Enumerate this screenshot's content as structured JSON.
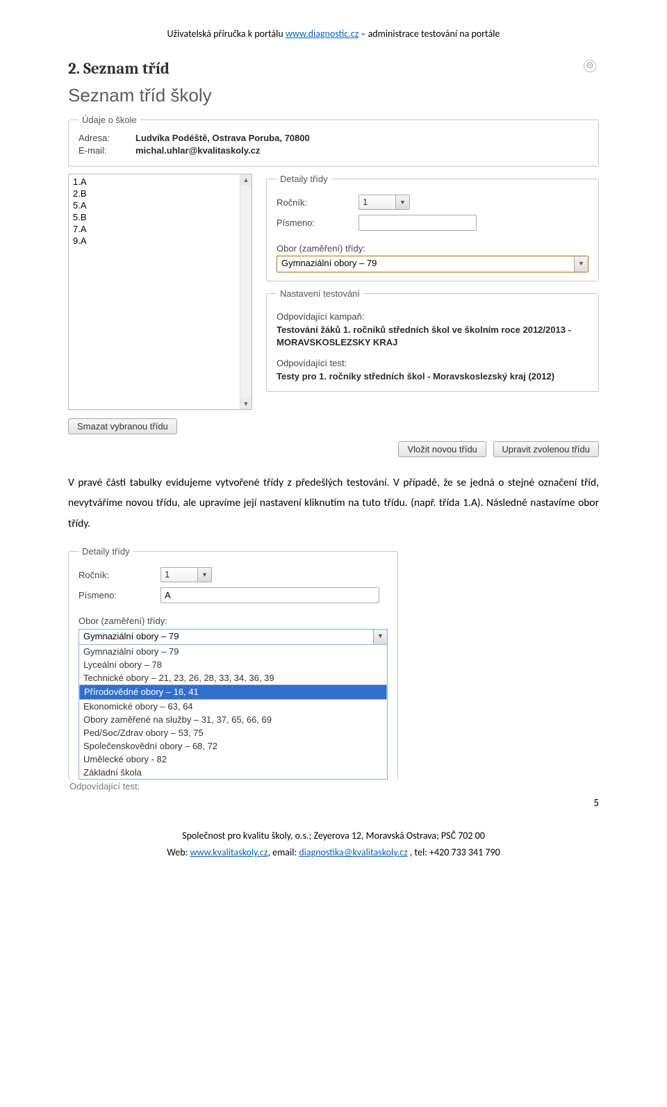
{
  "header": {
    "prefix": "Uživatelská příručka k portálu ",
    "link": "www.diagnostic.cz",
    "suffix": " – administrace testování na portále"
  },
  "heading": "2. Seznam tříd",
  "shot1": {
    "title": "Seznam tříd školy",
    "collapse_glyph": "⊝",
    "udaje_legend": "Údaje o škole",
    "adresa_label": "Adresa:",
    "adresa_value": "Ludvíka Podéště, Ostrava Poruba, 70800",
    "email_label": "E-mail:",
    "email_value": "michal.uhlar@kvalitaskoly.cz",
    "class_list": [
      "1.A",
      "2.B",
      "5.A",
      "5.B",
      "7.A",
      "9.A"
    ],
    "delete_btn": "Smazat vybranou třídu",
    "detaily_legend": "Detaily třídy",
    "rocnik_label": "Ročník:",
    "rocnik_value": "1",
    "pismeno_label": "Písmeno:",
    "pismeno_value": "",
    "obor_label": "Obor (zaměření) třídy:",
    "obor_value": "Gymnaziální obory – 79",
    "nastaveni_legend": "Nastavení testování",
    "kampan_label": "Odpovídající kampaň:",
    "kampan_value": "Testování žáků 1. ročníků středních škol ve školním roce 2012/2013 - MORAVSKOSLEZSKY KRAJ",
    "test_label": "Odpovídající test:",
    "test_value": "Testy pro 1. ročníky středních škol - Moravskoslezský kraj (2012)",
    "btn_insert": "Vložit novou třídu",
    "btn_edit": "Upravit zvolenou třídu"
  },
  "paragraph": "V pravé části tabulky evidujeme vytvořené třídy z předešlých testování. V případě, že se jedná o stejné označení tříd, nevytváříme novou třídu, ale upravíme její nastavení kliknutím na tuto třídu. (např. třída 1.A). Následně nastavíme obor třídy.",
  "shot2": {
    "detaily_legend": "Detaily třídy",
    "rocnik_label": "Ročník:",
    "rocnik_value": "1",
    "pismeno_label": "Písmeno:",
    "pismeno_value": "A",
    "obor_label": "Obor (zaměření) třídy:",
    "dd_selected": "Gymnaziální obory – 79",
    "dd_options": [
      "Gymnaziální obory – 79",
      "Lyceální obory – 78",
      "Technické obory – 21, 23, 26, 28, 33, 34, 36, 39",
      "Přírodovědné obory – 16, 41",
      "Ekonomické obory – 63, 64",
      "Obory zaměřené na služby – 31, 37, 65, 66, 69",
      "Ped/Soc/Zdrav obory – 53, 75",
      "Společenskovědní obory – 68, 72",
      "Umělecké obory - 82",
      "Základní škola"
    ],
    "dd_highlight_index": 3,
    "cutoff_text": "Odpovídající test:"
  },
  "page_number": "5",
  "footer": {
    "line1": "Společnost pro kvalitu školy, o.s.; Zeyerova 12, Moravská Ostrava; PSČ 702 00",
    "line2_prefix": "Web: ",
    "web_link": "www.kvalitaskoly.cz",
    "line2_mid": ", email: ",
    "email_link": "diagnostika@kvalitaskoly.cz",
    "line2_suffix": " , tel: +420 733 341 790"
  }
}
